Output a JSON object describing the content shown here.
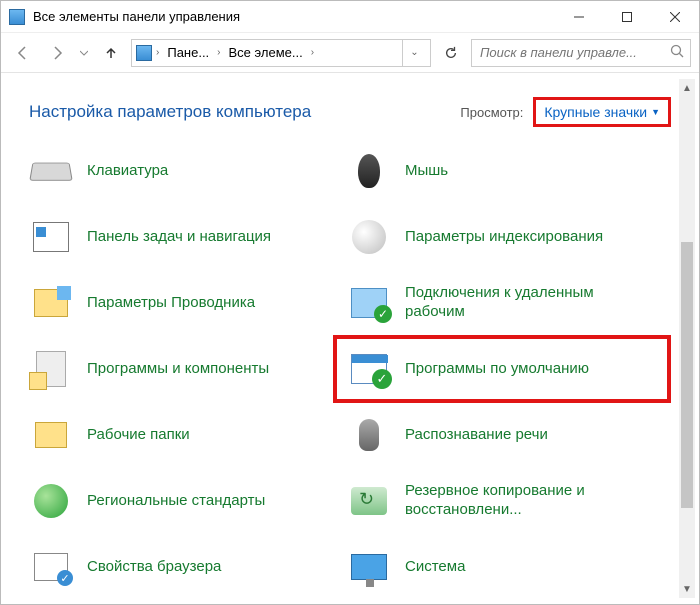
{
  "window": {
    "title": "Все элементы панели управления"
  },
  "breadcrumb": {
    "root": "Пане...",
    "current": "Все элеме..."
  },
  "search": {
    "placeholder": "Поиск в панели управле..."
  },
  "heading": "Настройка параметров компьютера",
  "view": {
    "label": "Просмотр:",
    "value": "Крупные значки"
  },
  "items": [
    {
      "label": "Клавиатура",
      "icon": "keyboard"
    },
    {
      "label": "Мышь",
      "icon": "mouse"
    },
    {
      "label": "Панель задач и навигация",
      "icon": "taskbar"
    },
    {
      "label": "Параметры индексирования",
      "icon": "index"
    },
    {
      "label": "Параметры Проводника",
      "icon": "explorer"
    },
    {
      "label": "Подключения к удаленным рабочим",
      "icon": "remote"
    },
    {
      "label": "Программы и компоненты",
      "icon": "programs"
    },
    {
      "label": "Программы по умолчанию",
      "icon": "defaults",
      "highlight": true
    },
    {
      "label": "Рабочие папки",
      "icon": "folders"
    },
    {
      "label": "Распознавание речи",
      "icon": "speech"
    },
    {
      "label": "Региональные стандарты",
      "icon": "globe"
    },
    {
      "label": "Резервное копирование и восстановлени...",
      "icon": "backup"
    },
    {
      "label": "Свойства браузера",
      "icon": "browser"
    },
    {
      "label": "Система",
      "icon": "system"
    }
  ]
}
